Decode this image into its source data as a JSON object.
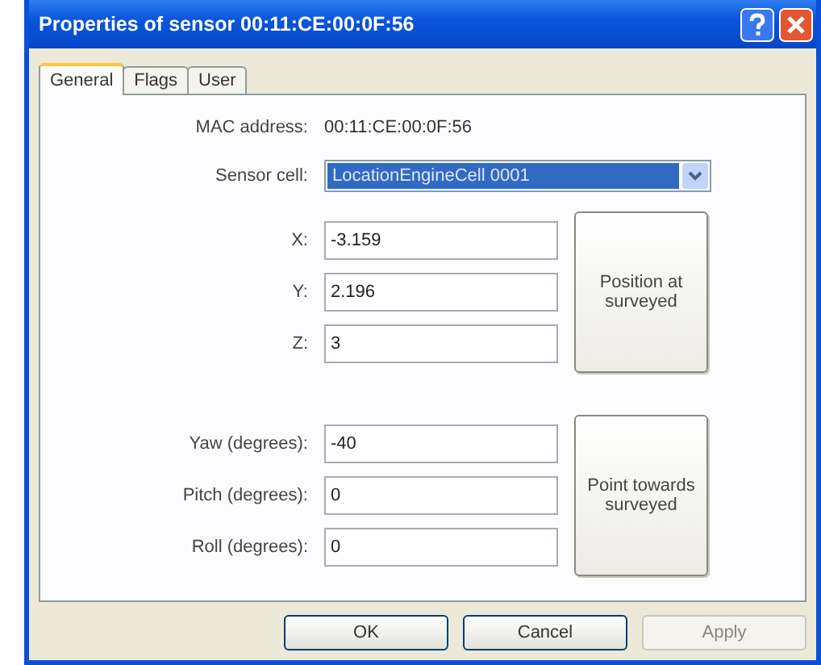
{
  "window": {
    "title": "Properties of sensor 00:11:CE:00:0F:56"
  },
  "tabs": [
    {
      "label": "General",
      "selected": true
    },
    {
      "label": "Flags",
      "selected": false
    },
    {
      "label": "User",
      "selected": false
    }
  ],
  "mac": {
    "label": "MAC address:",
    "value": "00:11:CE:00:0F:56"
  },
  "sensor_cell": {
    "label": "Sensor cell:",
    "value": "LocationEngineCell 0001",
    "selected": true
  },
  "position": {
    "fields": [
      {
        "label": "X:",
        "value": "-3.159"
      },
      {
        "label": "Y:",
        "value": "2.196"
      },
      {
        "label": "Z:",
        "value": "3"
      }
    ],
    "button": "Position at surveyed"
  },
  "orientation": {
    "fields": [
      {
        "label": "Yaw (degrees):",
        "value": "-40"
      },
      {
        "label": "Pitch (degrees):",
        "value": "0"
      },
      {
        "label": "Roll (degrees):",
        "value": "0"
      }
    ],
    "button": "Point towards surveyed"
  },
  "buttons": [
    {
      "label": "OK",
      "disabled": false
    },
    {
      "label": "Cancel",
      "disabled": false
    },
    {
      "label": "Apply",
      "disabled": true
    }
  ]
}
